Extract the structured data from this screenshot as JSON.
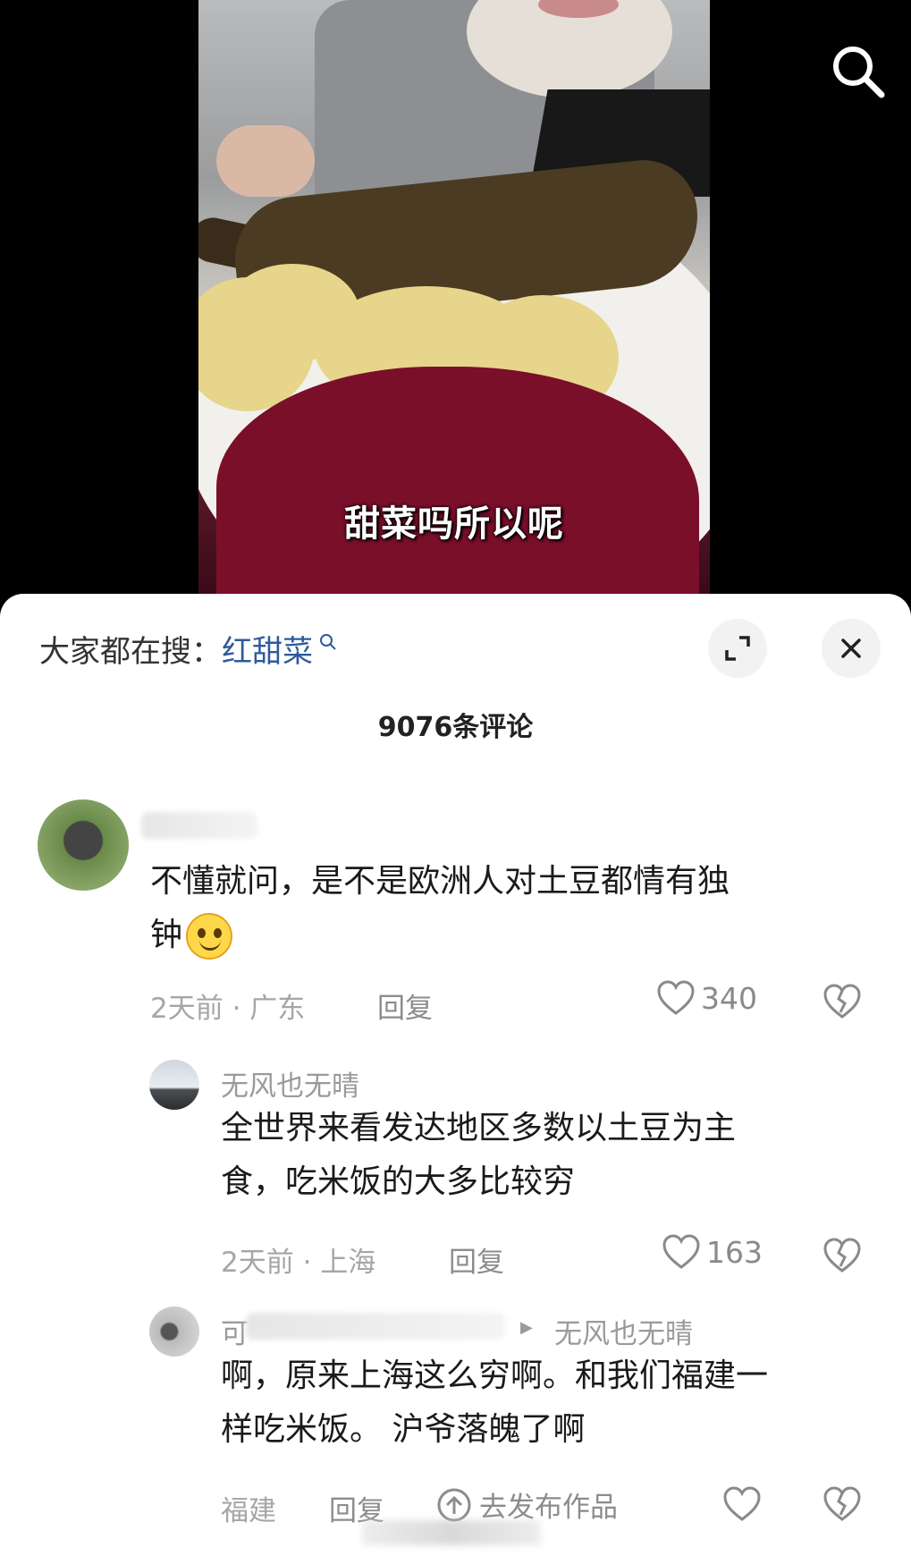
{
  "video": {
    "subtitle": "甜菜吗所以呢"
  },
  "top": {
    "search_icon": "search-icon"
  },
  "sheet": {
    "trending_prefix": "大家都在搜：",
    "trending_keyword": "红甜菜",
    "trending_icon": "search-icon",
    "expand_icon": "expand-icon",
    "close_icon": "close-icon",
    "comment_count": "9076条评论"
  },
  "comments": [
    {
      "avatar": "buffalo-avatar",
      "text_line1": "不懂就问，是不是欧洲人对土豆都情有独",
      "text_line2": "钟",
      "emoji": "smile-emoji",
      "time_location": "2天前 · 广东",
      "reply_label": "回复",
      "likes": "340"
    }
  ],
  "replies": [
    {
      "avatar": "windmill-avatar",
      "username": "无风也无晴",
      "text_line1": "全世界来看发达地区多数以土豆为主",
      "text_line2": "食，吃米饭的大多比较穷",
      "time_location": "2天前 · 上海",
      "reply_label": "回复",
      "likes": "163"
    },
    {
      "avatar": "gray-avatar",
      "username_fragment": "可",
      "reply_to": "无风也无晴",
      "text_line1": "啊，原来上海这么穷啊。和我们福建一",
      "text_line2": "样吃米饭。 沪爷落魄了啊",
      "location": "福建",
      "reply_label": "回复",
      "publish_label": "去发布作品"
    }
  ]
}
